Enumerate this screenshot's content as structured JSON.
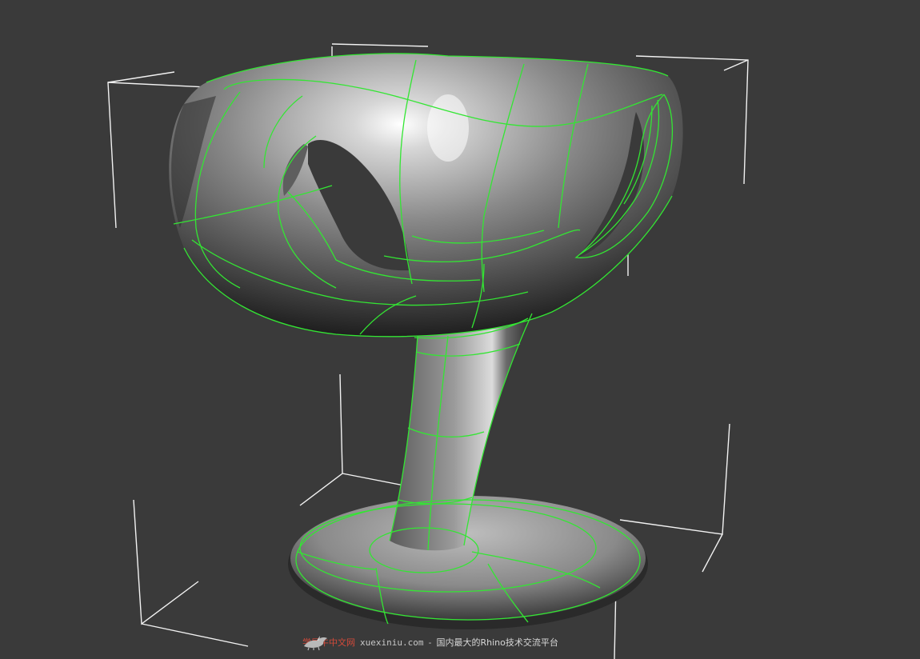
{
  "viewport": {
    "background_color": "#3a3a3a",
    "wireframe_color": "#33e633",
    "bounding_box_color": "#f2f2f2",
    "model_shade_color": "#7a7a7a"
  },
  "model": {
    "icon": "chair-3d-model"
  },
  "watermark": {
    "logo_icon": "rhino-logo-icon",
    "site_name_cn": "学犀牛中文网",
    "url": "xuexiniu.com",
    "separator": "-",
    "description": "国内最大的Rhino技术交流平台"
  }
}
